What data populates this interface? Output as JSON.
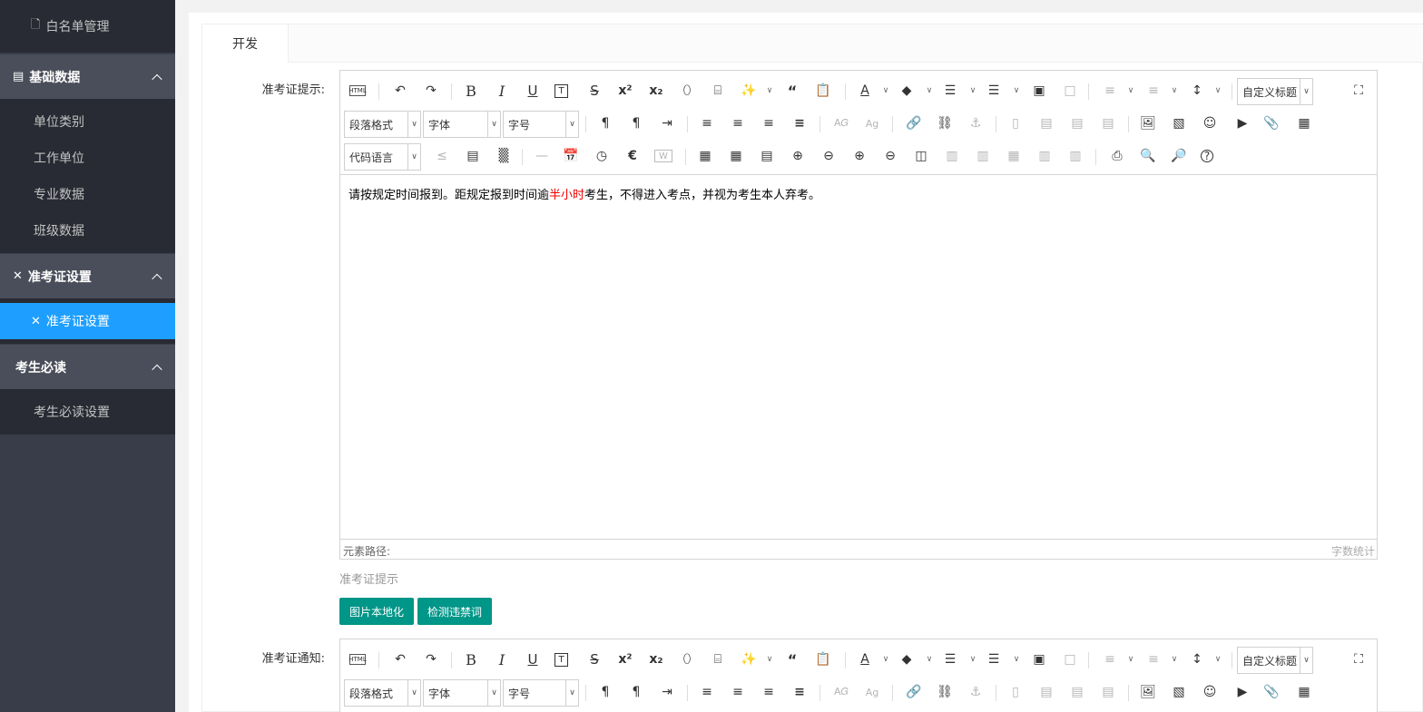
{
  "sidebar": {
    "items": [
      {
        "label": "白名单管理",
        "icon": "document-icon"
      },
      {
        "label": "基础数据",
        "icon": "list-icon"
      },
      {
        "label": "单位类别"
      },
      {
        "label": "工作单位"
      },
      {
        "label": "专业数据"
      },
      {
        "label": "班级数据"
      },
      {
        "label": "准考证设置",
        "icon": "wrench-icon"
      },
      {
        "label": "准考证设置",
        "icon": "wrench-icon"
      },
      {
        "label": "考生必读"
      },
      {
        "label": "考生必读设置"
      }
    ]
  },
  "tabs": [
    {
      "label": "开发"
    }
  ],
  "form": {
    "field1_label": "准考证提示:",
    "field2_label": "准考证通知:",
    "hint1": "准考证提示",
    "btn_localize": "图片本地化",
    "btn_detect": "检测违禁词"
  },
  "editor": {
    "combo_paragraph": "段落格式",
    "combo_font": "字体",
    "combo_size": "字号",
    "combo_heading": "自定义标题",
    "combo_code": "代码语言",
    "html_btn": "HTML",
    "content_before": "请按规定时间报到。距规定报到时间逾",
    "content_red": "半小时",
    "content_after": "考生，不得进入考点，并视为考生本人弃考。",
    "path_label": "元素路径:",
    "word_count_label": "字数统计"
  },
  "colors": {
    "sidebar_bg": "#393d49",
    "active": "#1e9fff",
    "button": "#009688",
    "emphasis": "#ee0000"
  }
}
